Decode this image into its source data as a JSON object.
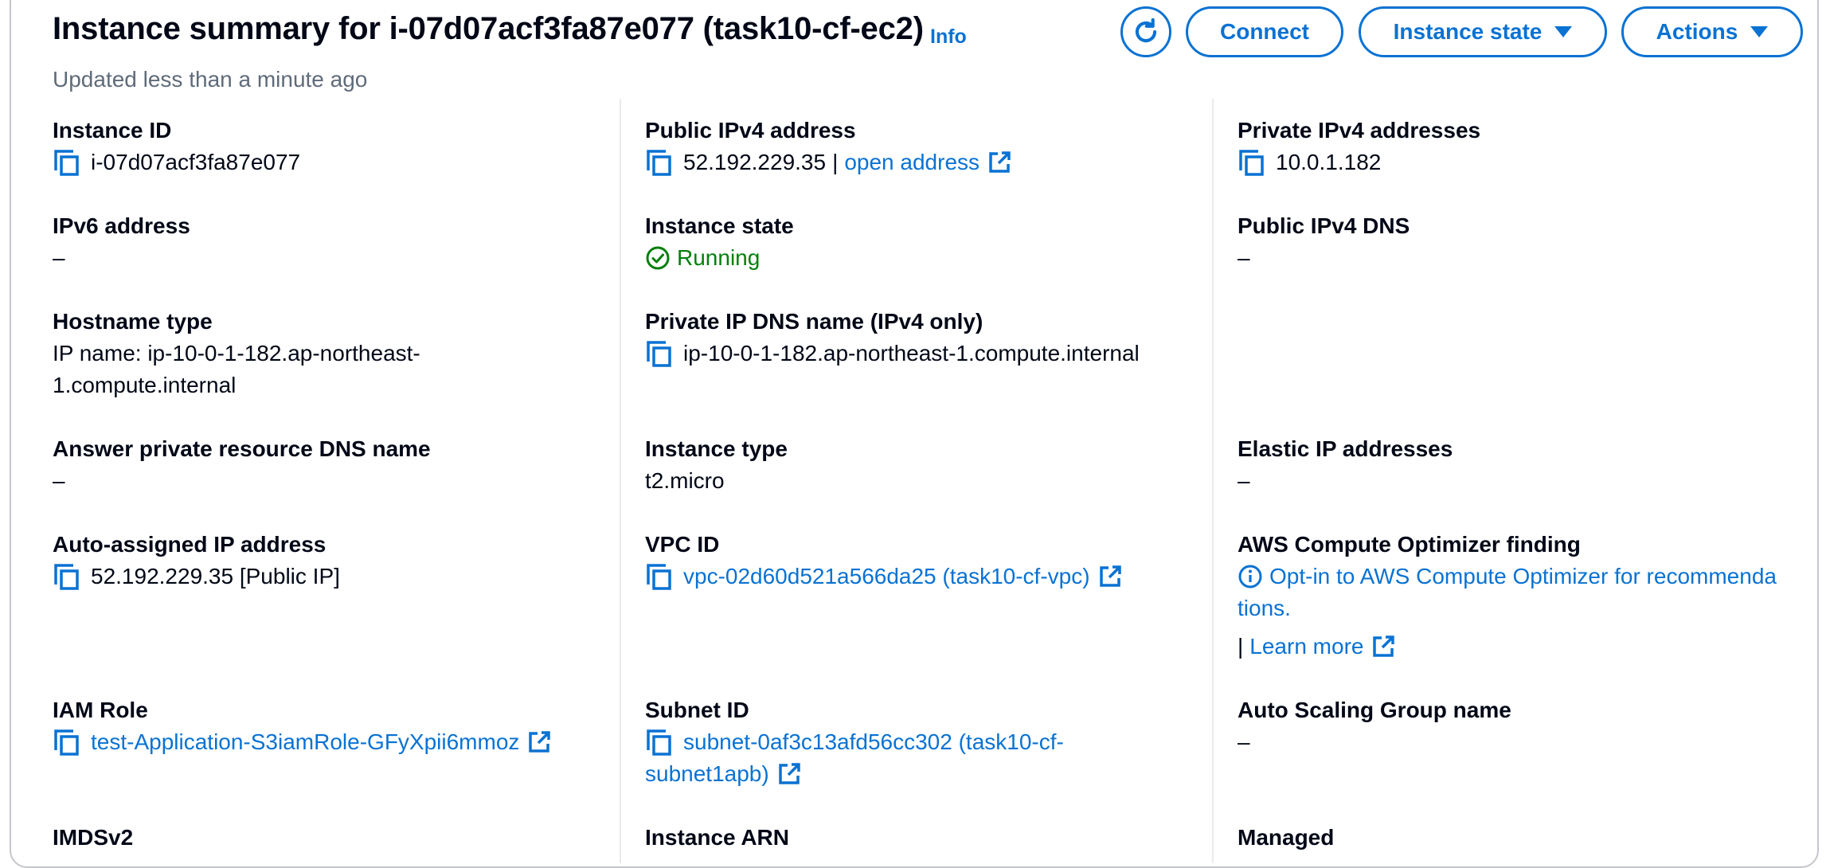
{
  "header": {
    "title": "Instance summary for i-07d07acf3fa87e077 (task10-cf-ec2)",
    "info_label": "Info",
    "subtitle": "Updated less than a minute ago",
    "buttons": {
      "connect": "Connect",
      "instance_state": "Instance state",
      "actions": "Actions"
    }
  },
  "colors": {
    "accent": "#0972d3",
    "success": "#037f0c",
    "text": "#000716",
    "muted": "#5f6b7a"
  },
  "col1": {
    "instance_id": {
      "label": "Instance ID",
      "value": "i-07d07acf3fa87e077"
    },
    "ipv6": {
      "label": "IPv6 address",
      "value": "–"
    },
    "hostname_type": {
      "label": "Hostname type",
      "value_line1": "IP name: ip-10-0-1-182.ap-northeast-",
      "value_line2": "1.compute.internal"
    },
    "answer_dns": {
      "label": "Answer private resource DNS name",
      "value": "–"
    },
    "auto_ip": {
      "label": "Auto-assigned IP address",
      "value": "52.192.229.35 [Public IP]"
    },
    "iam_role": {
      "label": "IAM Role",
      "value": "test-Application-S3iamRole-GFyXpii6mmoz"
    },
    "imdsv2": {
      "label": "IMDSv2"
    }
  },
  "col2": {
    "public_ipv4": {
      "label": "Public IPv4 address",
      "value": "52.192.229.35",
      "separator": "|",
      "link": "open address"
    },
    "instance_state": {
      "label": "Instance state",
      "value": "Running"
    },
    "private_dns": {
      "label": "Private IP DNS name (IPv4 only)",
      "value": "ip-10-0-1-182.ap-northeast-1.compute.internal"
    },
    "instance_type": {
      "label": "Instance type",
      "value": "t2.micro"
    },
    "vpc_id": {
      "label": "VPC ID",
      "value": "vpc-02d60d521a566da25 (task10-cf-vpc)"
    },
    "subnet_id": {
      "label": "Subnet ID",
      "value_line1": "subnet-0af3c13afd56cc302 (task10-cf-",
      "value_line2": "subnet1apb)"
    },
    "instance_arn": {
      "label": "Instance ARN"
    }
  },
  "col3": {
    "private_ipv4": {
      "label": "Private IPv4 addresses",
      "value": "10.0.1.182"
    },
    "public_dns": {
      "label": "Public IPv4 DNS",
      "value": "–"
    },
    "elastic_ip": {
      "label": "Elastic IP addresses",
      "value": "–"
    },
    "optimizer": {
      "label": "AWS Compute Optimizer finding",
      "value_line1": "Opt-in to AWS Compute Optimizer for recommenda",
      "value_line2": "tions.",
      "separator": "|",
      "learn_more": "Learn more"
    },
    "asg": {
      "label": "Auto Scaling Group name",
      "value": "–"
    },
    "managed": {
      "label": "Managed"
    }
  }
}
